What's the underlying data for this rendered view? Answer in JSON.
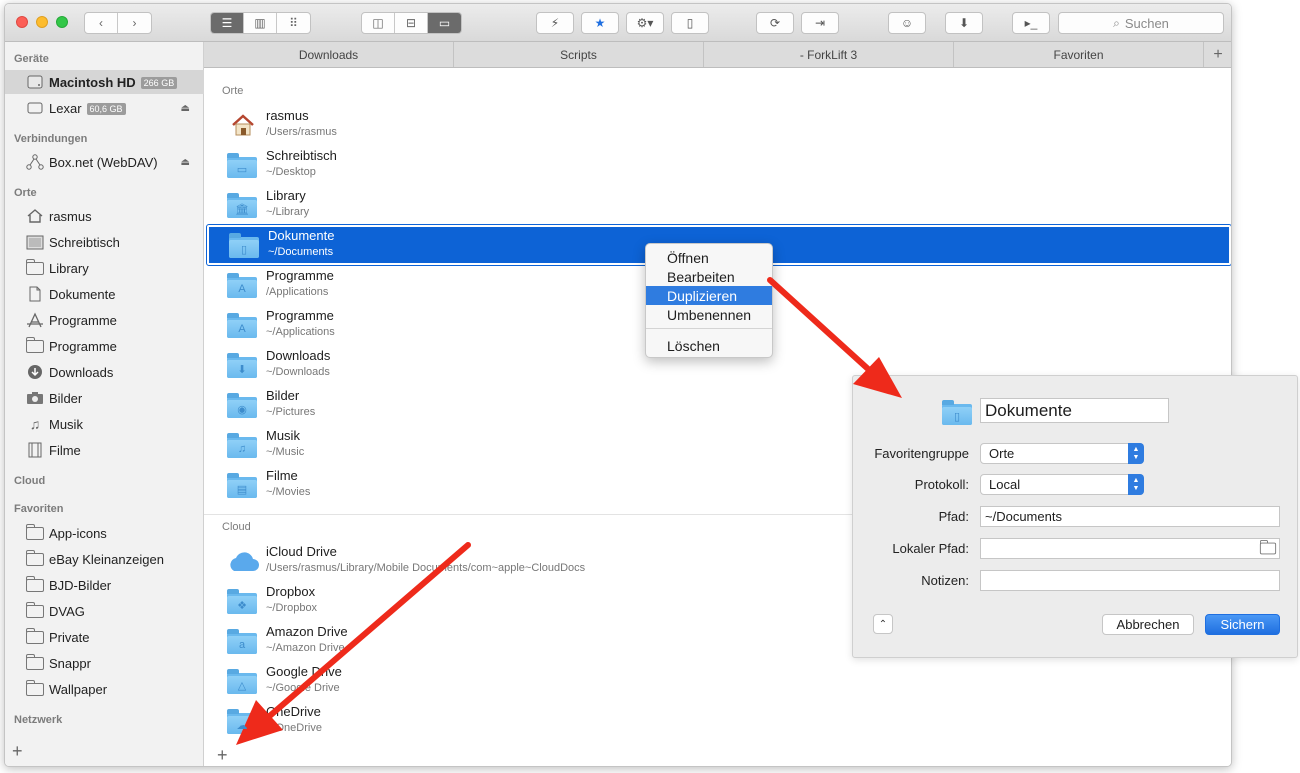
{
  "toolbar": {
    "search_placeholder": "Suchen",
    "view_buttons": [
      "list-view",
      "column-view",
      "icon-view"
    ],
    "pane_buttons": [
      "dual-pane",
      "split-horizontal",
      "single-pane"
    ]
  },
  "sidebar": {
    "sections": [
      {
        "title": "Geräte"
      },
      {
        "title": "Verbindungen"
      },
      {
        "title": "Orte"
      },
      {
        "title": "Cloud"
      },
      {
        "title": "Favoriten"
      },
      {
        "title": "Netzwerk"
      }
    ],
    "devices": [
      {
        "label": "Macintosh HD",
        "badge": "266 GB",
        "icon": "harddisk-icon",
        "selected": true
      },
      {
        "label": "Lexar",
        "badge": "60,6 GB",
        "icon": "external-disk-icon",
        "eject": true
      }
    ],
    "connections": [
      {
        "label": "Box.net (WebDAV)",
        "icon": "network-node-icon",
        "eject": true
      }
    ],
    "places": [
      {
        "label": "rasmus",
        "icon": "home-icon"
      },
      {
        "label": "Schreibtisch",
        "icon": "desktop-icon"
      },
      {
        "label": "Library",
        "icon": "folder-icon"
      },
      {
        "label": "Dokumente",
        "icon": "document-icon"
      },
      {
        "label": "Programme",
        "icon": "applications-icon"
      },
      {
        "label": "Programme",
        "icon": "folder-icon"
      },
      {
        "label": "Downloads",
        "icon": "download-icon"
      },
      {
        "label": "Bilder",
        "icon": "camera-icon"
      },
      {
        "label": "Musik",
        "icon": "music-icon"
      },
      {
        "label": "Filme",
        "icon": "film-icon"
      }
    ],
    "favorites": [
      {
        "label": "App-icons"
      },
      {
        "label": "eBay Kleinanzeigen"
      },
      {
        "label": "BJD-Bilder"
      },
      {
        "label": "DVAG"
      },
      {
        "label": "Private"
      },
      {
        "label": "Snappr"
      },
      {
        "label": "Wallpaper"
      }
    ]
  },
  "tabs": [
    "Downloads",
    "Scripts",
    "- ForkLift 3",
    "Favoriten"
  ],
  "main": {
    "section_places": "Orte",
    "section_cloud": "Cloud",
    "places": [
      {
        "name": "rasmus",
        "path": "/Users/rasmus",
        "icon": "home-icon"
      },
      {
        "name": "Schreibtisch",
        "path": "~/Desktop",
        "icon": "desktop-folder-icon"
      },
      {
        "name": "Library",
        "path": "~/Library",
        "icon": "library-folder-icon"
      },
      {
        "name": "Dokumente",
        "path": "~/Documents",
        "icon": "documents-folder-icon",
        "selected": true
      },
      {
        "name": "Programme",
        "path": "/Applications",
        "icon": "applications-folder-icon"
      },
      {
        "name": "Programme",
        "path": "~/Applications",
        "icon": "applications-folder-icon"
      },
      {
        "name": "Downloads",
        "path": "~/Downloads",
        "icon": "downloads-folder-icon"
      },
      {
        "name": "Bilder",
        "path": "~/Pictures",
        "icon": "pictures-folder-icon"
      },
      {
        "name": "Musik",
        "path": "~/Music",
        "icon": "music-folder-icon"
      },
      {
        "name": "Filme",
        "path": "~/Movies",
        "icon": "movies-folder-icon"
      }
    ],
    "cloud": [
      {
        "name": "iCloud Drive",
        "path": "/Users/rasmus/Library/Mobile Documents/com~apple~CloudDocs",
        "icon": "icloud-icon"
      },
      {
        "name": "Dropbox",
        "path": "~/Dropbox",
        "icon": "dropbox-folder-icon"
      },
      {
        "name": "Amazon Drive",
        "path": "~/Amazon Drive",
        "icon": "amazon-drive-folder-icon"
      },
      {
        "name": "Google Drive",
        "path": "~/Google Drive",
        "icon": "google-drive-folder-icon"
      },
      {
        "name": "OneDrive",
        "path": "~/OneDrive",
        "icon": "onedrive-folder-icon"
      }
    ]
  },
  "context_menu": {
    "items": [
      "Öffnen",
      "Bearbeiten",
      "Duplizieren",
      "Umbenennen"
    ],
    "highlighted": "Duplizieren",
    "delete_label": "Löschen"
  },
  "edit_panel": {
    "name_value": "Dokumente",
    "group_label": "Favoritengruppe",
    "group_value": "Orte",
    "protocol_label": "Protokoll:",
    "protocol_value": "Local",
    "path_label": "Pfad:",
    "path_value": "~/Documents",
    "local_path_label": "Lokaler Pfad:",
    "local_path_value": "",
    "notes_label": "Notizen:",
    "notes_value": "",
    "cancel_label": "Abbrechen",
    "save_label": "Sichern"
  },
  "colors": {
    "selection": "#0d63d6",
    "menu_highlight": "#2f7ce0",
    "annotation_arrow": "#ee2a1b",
    "folder_blue": "#6ab9ee"
  }
}
